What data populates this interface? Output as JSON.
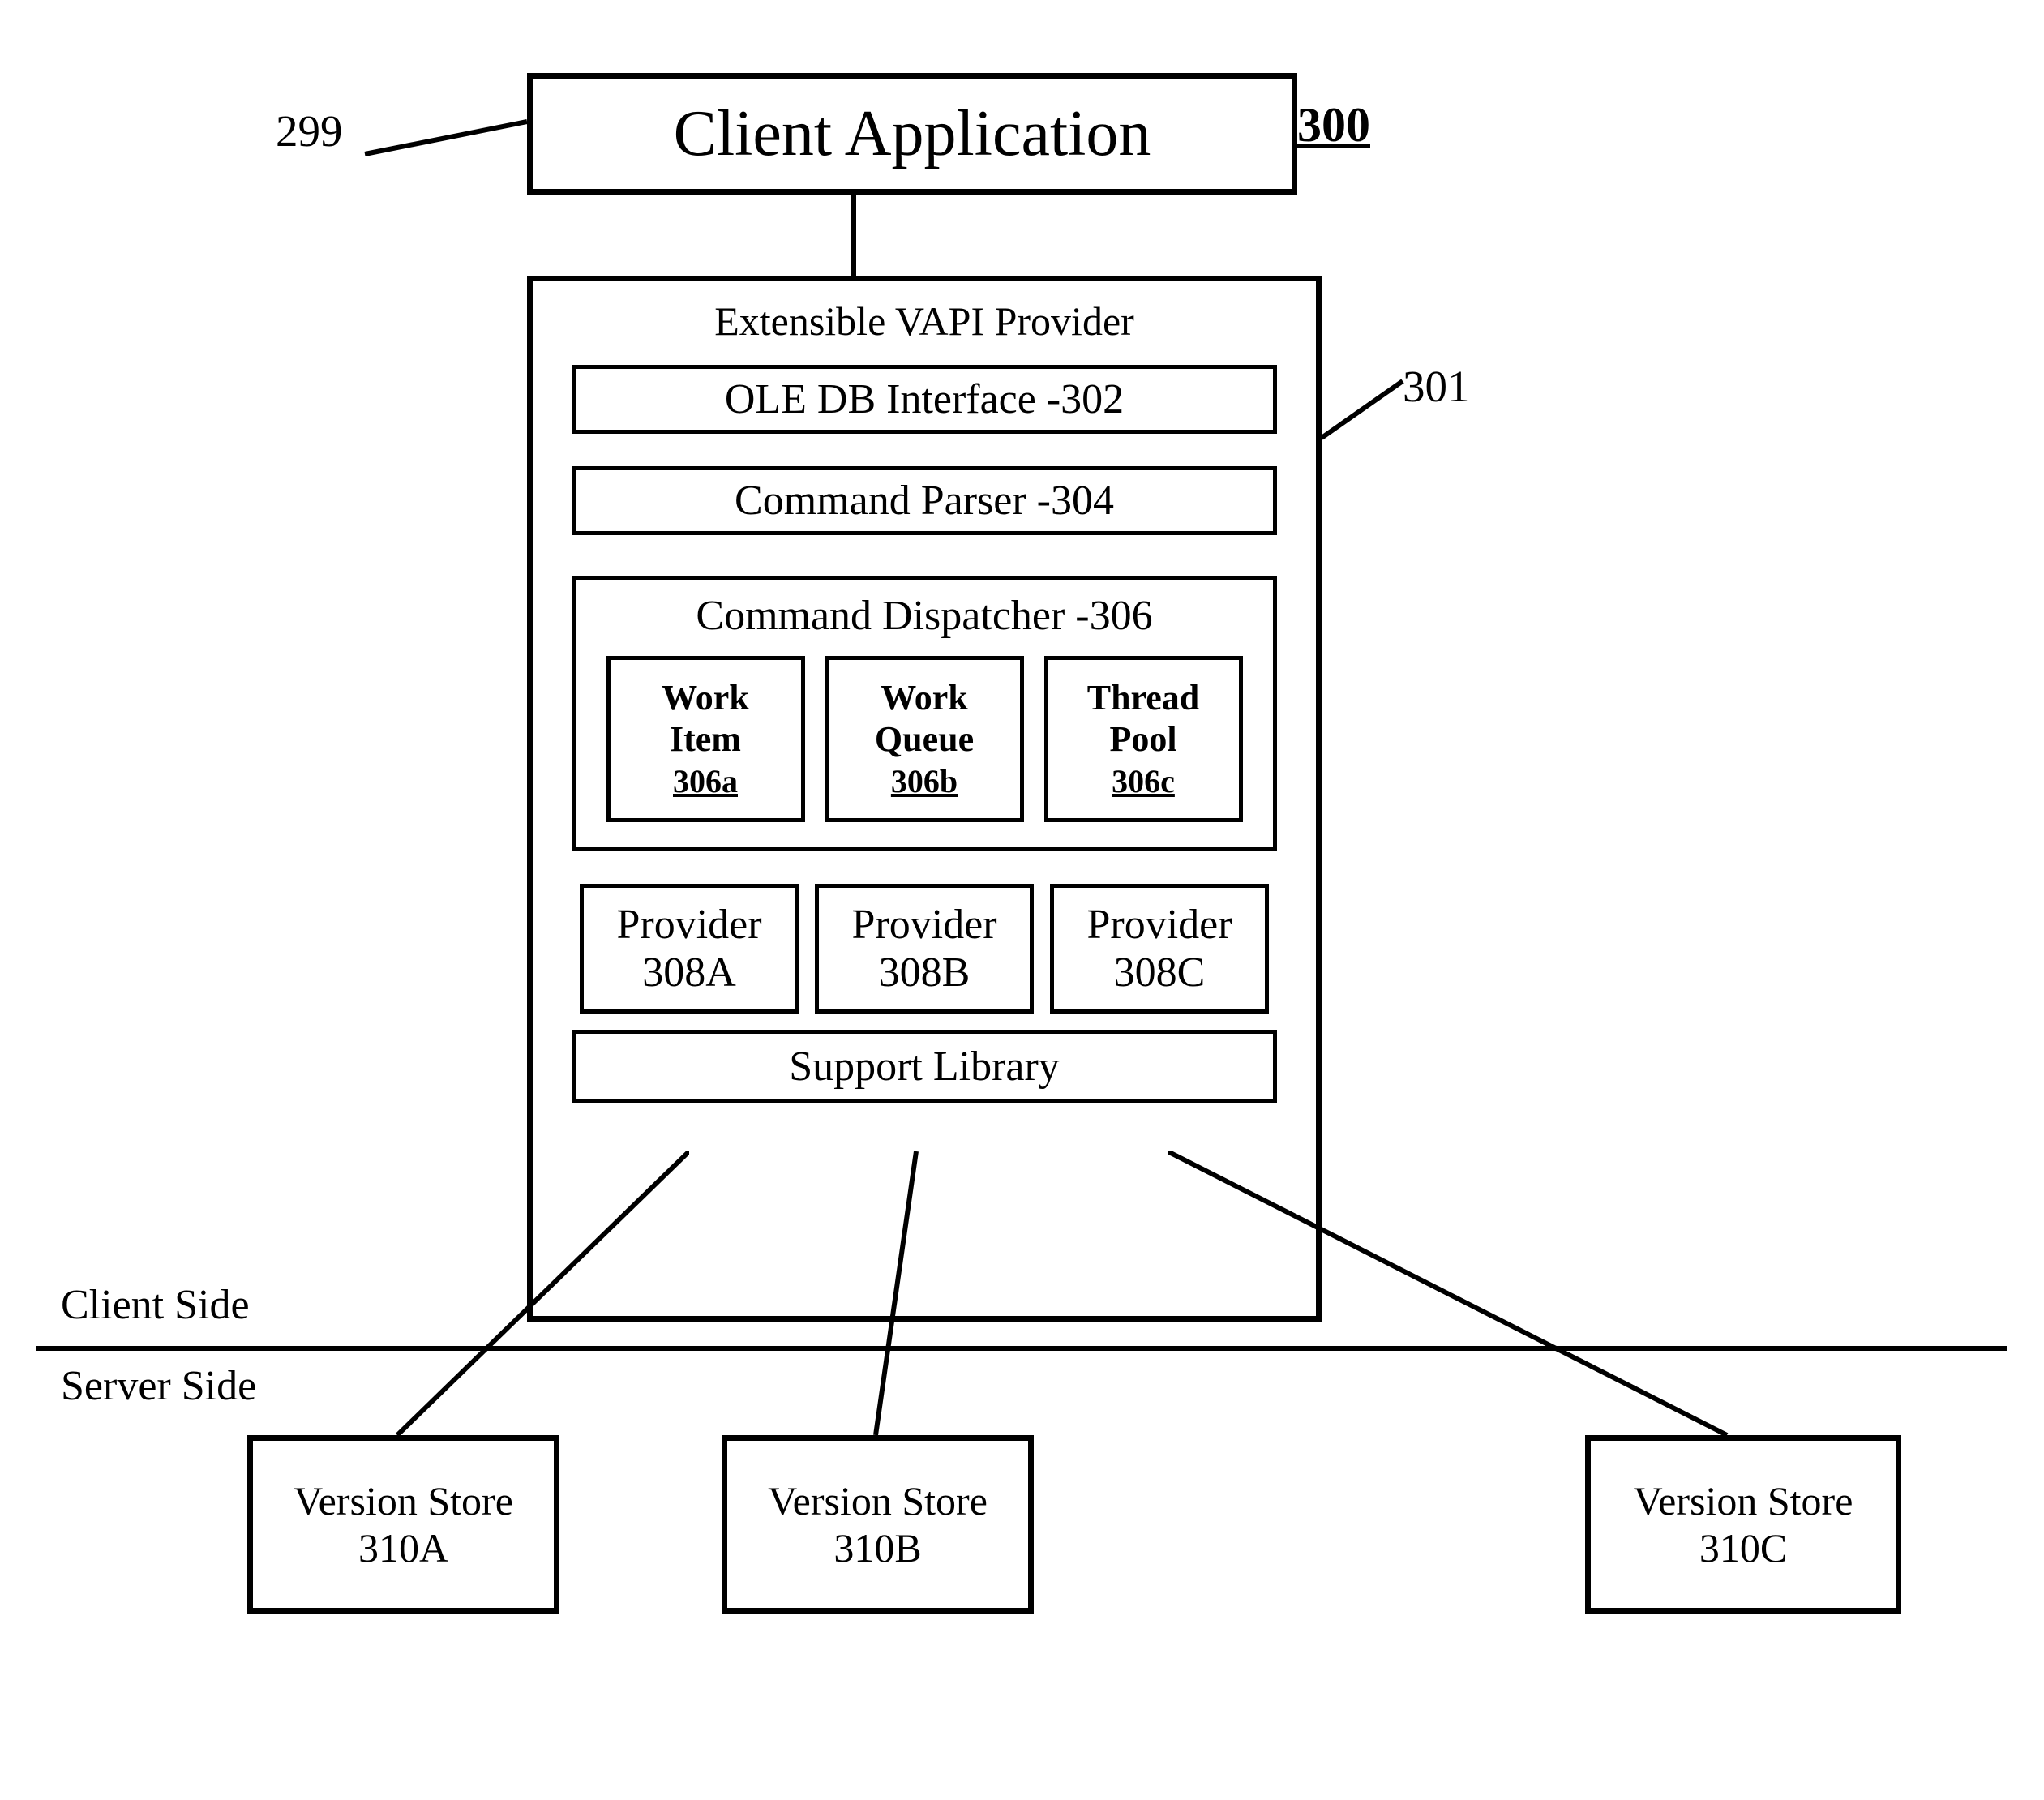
{
  "figureNumber": "300",
  "clientApp": {
    "refNum": "299",
    "title": "Client Application"
  },
  "vapiProvider": {
    "refNum": "301",
    "title": "Extensible VAPI  Provider",
    "oleDb": "OLE   DB Interface -302",
    "commandParser": "Command Parser -304",
    "commandDispatcher": {
      "title": "Command Dispatcher -306",
      "workItem": {
        "name": "Work Item",
        "ref": "306a"
      },
      "workQueue": {
        "name": "Work Queue",
        "ref": "306b"
      },
      "threadPool": {
        "name": "Thread Pool",
        "ref": "306c"
      }
    },
    "providers": {
      "a": {
        "name": "Provider",
        "ref": "308A"
      },
      "b": {
        "name": "Provider",
        "ref": "308B"
      },
      "c": {
        "name": "Provider",
        "ref": "308C"
      }
    },
    "supportLibrary": "Support Library"
  },
  "sides": {
    "client": "Client Side",
    "server": "Server Side"
  },
  "versionStores": {
    "a": {
      "name": "Version Store",
      "ref": "310A"
    },
    "b": {
      "name": "Version Store",
      "ref": "310B"
    },
    "c": {
      "name": "Version Store",
      "ref": "310C"
    }
  }
}
